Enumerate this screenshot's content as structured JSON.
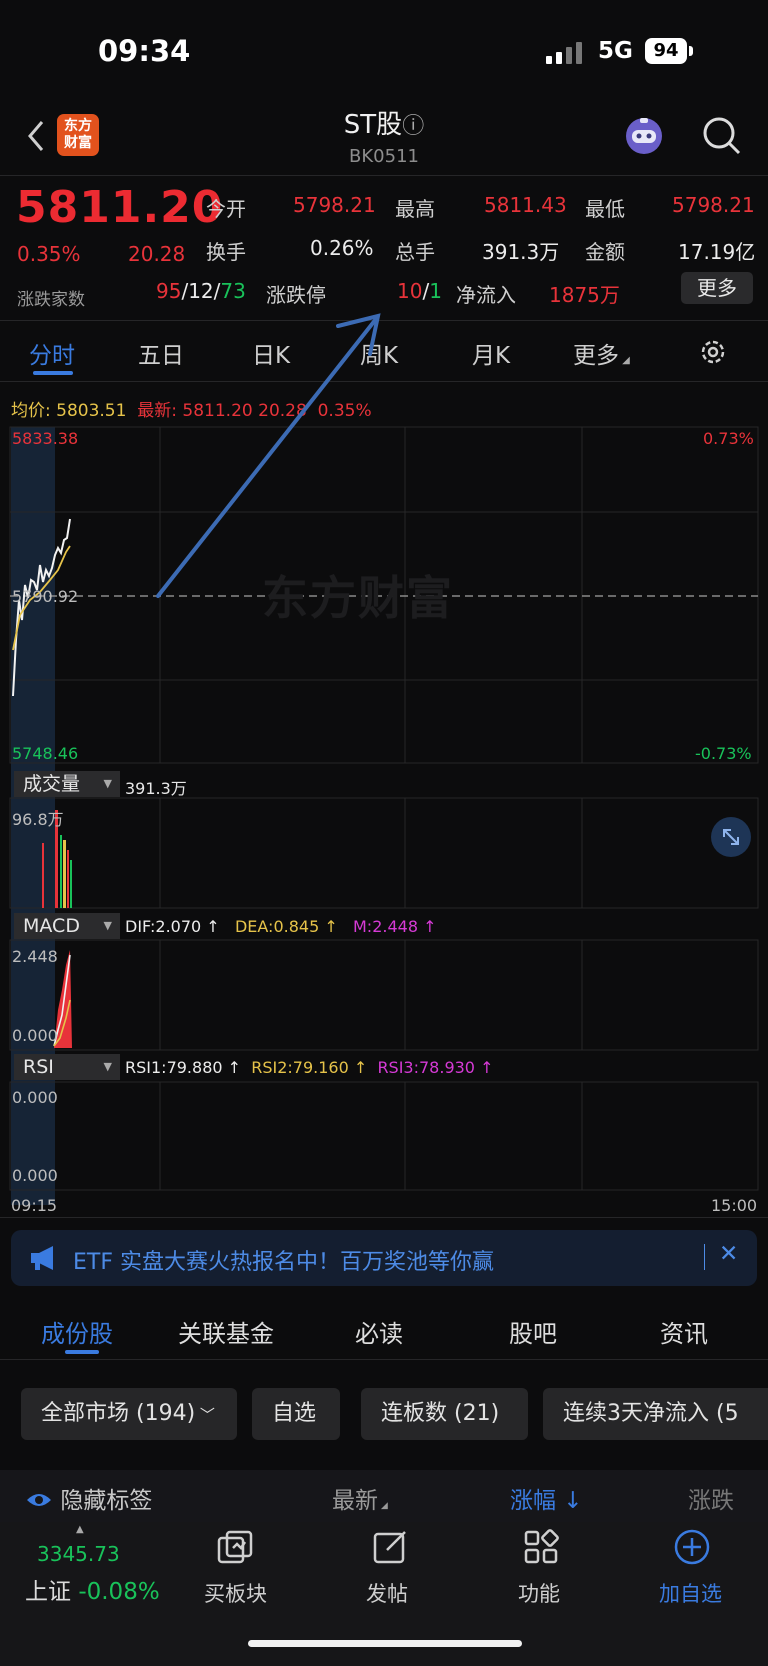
{
  "status_bar": {
    "time": "09:34",
    "network": "5G",
    "battery": "94"
  },
  "header": {
    "back_icon": "chevron-left-icon",
    "logo_text_1": "东方",
    "logo_text_2": "财富",
    "title": "ST股",
    "info_icon": "ⓘ",
    "code": "BK0511"
  },
  "quote": {
    "price": "5811.20",
    "change_pct": "0.35%",
    "change": "20.28",
    "breadth_label": "涨跌家数",
    "breadth_up": "95",
    "breadth_sep1": "/",
    "breadth_flat": "12",
    "breadth_sep2": "/",
    "breadth_down": "73",
    "open_label": "今开",
    "open": "5798.21",
    "high_label": "最高",
    "high": "5811.43",
    "low_label": "最低",
    "low": "5798.21",
    "turnover_label": "换手",
    "turnover": "0.26%",
    "volume_label": "总手",
    "volume": "391.3万",
    "amount_label": "金额",
    "amount": "17.19亿",
    "limit_label": "涨跌停",
    "limit_up": "10",
    "limit_sep": "/",
    "limit_down": "1",
    "inflow_label": "净流入",
    "inflow": "1875万",
    "more_button": "更多"
  },
  "tabs": [
    "分时",
    "五日",
    "日K",
    "周K",
    "月K",
    "更多"
  ],
  "chart": {
    "avg_label": "均价:",
    "avg_value": "5803.51",
    "latest_label": "最新:",
    "latest_value": "5811.20",
    "latest_change": "20.28",
    "latest_pct": "0.35%",
    "y_top": "5833.38",
    "y_mid": "5790.92",
    "y_bottom": "5748.46",
    "pct_top": "0.73%",
    "pct_bottom": "-0.73%",
    "watermark": "东方财富",
    "volume_selector": "成交量",
    "volume_value": "391.3万",
    "volume_max": "96.8万",
    "macd_selector": "MACD",
    "dif": "DIF:2.070 ↑",
    "dea": "DEA:0.845 ↑",
    "m": "M:2.448 ↑",
    "macd_top": "2.448",
    "macd_bottom": "0.000",
    "rsi_selector": "RSI",
    "rsi1": "RSI1:79.880 ↑",
    "rsi2": "RSI2:79.160 ↑",
    "rsi3": "RSI3:78.930 ↑",
    "rsi_top": "0.000",
    "rsi_bottom": "0.000",
    "time_start": "09:15",
    "time_end": "15:00"
  },
  "banner": {
    "text": "ETF 实盘大赛火热报名中！百万奖池等你赢",
    "close": "✕"
  },
  "bottom_tabs": [
    "成份股",
    "关联基金",
    "必读",
    "股吧",
    "资讯"
  ],
  "filters": [
    "全部市场 (194)",
    "自选",
    "连板数 (21)",
    "连续3天净流入 (5"
  ],
  "columns": {
    "hide_tags": "隐藏标签",
    "latest": "最新",
    "change_pct": "涨幅",
    "change": "涨跌"
  },
  "nav": {
    "index_value": "3345.73",
    "index_name": "上证",
    "index_pct": "-0.08%",
    "buy_block": "买板块",
    "post": "发帖",
    "functions": "功能",
    "add_watch": "加自选"
  }
}
